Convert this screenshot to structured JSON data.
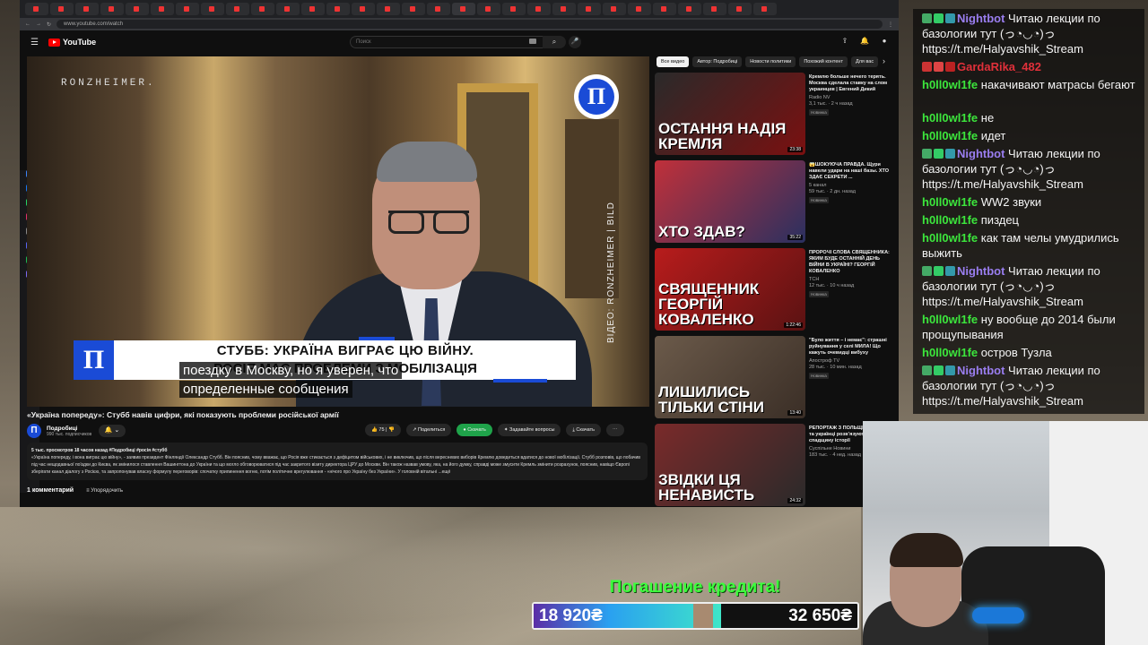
{
  "browser": {
    "tab_count": 30,
    "url": "www.youtube.com/watch"
  },
  "youtube": {
    "logo_text": "YouTube",
    "search_placeholder": "Поиск"
  },
  "video": {
    "watermark": "RONZHEIMER.",
    "credit_vertical": "ВІДЕО: RONZHEIMER | BILD",
    "logo_letter": "П",
    "lower_third_line1": "СТУББ: УКРАЇНА ВИГРАЄ ЦЮ ВІЙНУ.",
    "lower_third_line2": "РОСІЯ МАЄ ПРОБЛЕМИ З МОБІЛІЗАЦІЯ",
    "subtitle_line1": "поездку в Москву, но я уверен, что",
    "subtitle_line2": "определенные сообщения",
    "title": "«Україна попереду»: Стубб навів цифри, які показують проблеми російської армії",
    "channel_letter": "П",
    "channel_name": "Подробиці",
    "channel_subs": "990 тыс. подписчиков",
    "likes": "75",
    "share_label": "Поделиться",
    "save_label": "Скачать",
    "green_button": "Скачать",
    "ask_label": "Задавайте вопросы",
    "description_meta": "5 тыс. просмотров  18 часов назад  #Подробиці #росія #стубб",
    "description_text": "«Україна попереду, і вона виграє цю війну», - заявив президент Фінляндії Олександр Стубб. Він пояснив, чому вважає, що Росія вже стикається з дефіцитом військових, і не виключив, що після вересневих виборів Кремлю доведеться вдатися до нової мобілізації. Стубб розповів, що побачив під час нещодавньої поїздки до Києва, як змінилося ставлення Вашингтона до України та що могло обговорюватися під час закритого візиту директора ЦРУ до Москви. Він також назвав умову, яка, на його думку, справді може змусити Кремль змінити розрахунок, пояснив, навіщо Європі зберігати канал діалогу з Росією, та запропонував власну формулу переговорів: спочатку припинення вогню, потім політичне врегулювання - «нічого про Україну без України». У головній вітальні ...ещё",
    "comments_count": "1 комментарий",
    "sort_label": "Упорядочить"
  },
  "chips": [
    "Все видео",
    "Автор: Подробиці",
    "Новости политики",
    "Похожий контент",
    "Для вас"
  ],
  "recommendations": [
    {
      "caption": "ОСТАННЯ НАДІЯ КРЕМЛЯ",
      "duration": "23:38",
      "title": "Кремлю больше нечего терять. Москва сделала ставку на слом украинцев | Евгений Дикий",
      "channel": "Radio NV",
      "views": "3,1 тыс. · 2 ч назад",
      "badge": "Новинка",
      "color1": "#2a2a2a",
      "color2": "#7a1010"
    },
    {
      "caption": "ХТО ЗДАВ?",
      "duration": "35:22",
      "title": "😱ШОКУЮЧА ПРАВДА. Щури навели удари на наші базы. ХТО ЗДАЄ СЕКРЕТИ ...",
      "channel": "5 канал",
      "views": "59 тыс. · 2 дн. назад",
      "badge": "Новинка",
      "color1": "#c0303a",
      "color2": "#2a3060"
    },
    {
      "caption": "СВЯЩЕННИК ГЕОРГІЙ КОВАЛЕНКО",
      "duration": "1:22:46",
      "title": "ПРОРОЧІ СЛОВА СВЯЩЕННИКА: ЯКИМ БУДЕ ОСТАННІЙ ДЕНЬ ВІЙНИ В УКРАЇНІ? ГЕОРГІЙ КОВАЛЕНКО",
      "channel": "ТСН",
      "views": "12 тыс. · 10 ч назад",
      "badge": "Новинка",
      "color1": "#b81c1c",
      "color2": "#5a1212"
    },
    {
      "caption": "ЛИШИЛИСЬ ТІЛЬКИ СТІНИ",
      "duration": "13:40",
      "title": "\"Було життя – і немає\": страшні руйнування у селі МИЛА! Що кажуть очевидці вибуху",
      "channel": "Апостроф TV",
      "views": "28 тыс. · 10 мин. назад",
      "badge": "Новинка",
      "color1": "#6b5a4a",
      "color2": "#3a2e26"
    },
    {
      "caption": "ЗВІДКИ ЦЯ НЕНАВИСТЬ",
      "duration": "24:32",
      "title": "РЕПОРТАЖ З ПОЛЬЩІ | Як поляки та українці розвʼязують складну спадщину історії",
      "channel": "Суспільне Новини",
      "views": "183 тыс. · 4 нед. назад",
      "badge": "",
      "color1": "#7a2a2a",
      "color2": "#2a2a2a"
    }
  ],
  "chat": [
    {
      "user": "Nightbot",
      "color": "#9a7ef0",
      "badges": [
        "#4a6",
        "#3c6",
        "#39a"
      ],
      "text": "Читаю лекции по базологии тут (っ◔◡◔)っ https://t.me/Halyavshik_Stream"
    },
    {
      "user": "GardaRika_482",
      "color": "#e0303a",
      "badges": [
        "#c33",
        "#d44",
        "#b22"
      ],
      "text": ""
    },
    {
      "user": "h0ll0wl1fe",
      "color": "#3ce63c",
      "badges": [],
      "text": "накачивают матрасы бегают"
    },
    {
      "user": "h0ll0wl1fe",
      "color": "#3ce63c",
      "badges": [],
      "text": "не"
    },
    {
      "user": "h0ll0wl1fe",
      "color": "#3ce63c",
      "badges": [],
      "text": "идет"
    },
    {
      "user": "Nightbot",
      "color": "#9a7ef0",
      "badges": [
        "#4a6",
        "#3c6",
        "#39a"
      ],
      "text": "Читаю лекции по базологии тут (っ◔◡◔)っ https://t.me/Halyavshik_Stream"
    },
    {
      "user": "h0ll0wl1fe",
      "color": "#3ce63c",
      "badges": [],
      "text": "WW2 звуки"
    },
    {
      "user": "h0ll0wl1fe",
      "color": "#3ce63c",
      "badges": [],
      "text": "пиздец"
    },
    {
      "user": "h0ll0wl1fe",
      "color": "#3ce63c",
      "badges": [],
      "text": "как там челы умудрились выжить"
    },
    {
      "user": "Nightbot",
      "color": "#9a7ef0",
      "badges": [
        "#4a6",
        "#3c6",
        "#39a"
      ],
      "text": "Читаю лекции по базологии тут (っ◔◡◔)っ https://t.me/Halyavshik_Stream"
    },
    {
      "user": "h0ll0wl1fe",
      "color": "#3ce63c",
      "badges": [],
      "text": "ну вообще до 2014 были прощупывания"
    },
    {
      "user": "h0ll0wl1fe",
      "color": "#3ce63c",
      "badges": [],
      "text": "остров Тузла"
    },
    {
      "user": "Nightbot",
      "color": "#9a7ef0",
      "badges": [
        "#4a6",
        "#3c6",
        "#39a"
      ],
      "text": "Читаю лекции по базологии тут (っ◔◡◔)っ https://t.me/Halyavshik_Stream"
    }
  ],
  "credit": {
    "title": "Погашение кредита!",
    "current": "18 920₴",
    "goal": "32 650₴",
    "progress": 0.58
  }
}
